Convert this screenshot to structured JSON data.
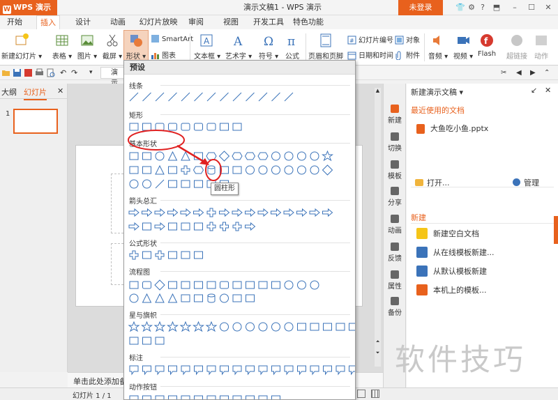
{
  "app": {
    "name": "WPS 演示",
    "logo": "W"
  },
  "window": {
    "title": "演示文稿1 - WPS 演示",
    "login_label": "未登录"
  },
  "menu_tabs": [
    "开始",
    "插入",
    "设计",
    "动画",
    "幻灯片放映",
    "审阅",
    "视图",
    "开发工具",
    "特色功能"
  ],
  "active_tab": "插入",
  "ribbon": {
    "new_slide": "新建幻灯片",
    "table": "表格",
    "picture": "图片",
    "screenshot": "截屏",
    "shape": "形状",
    "smartart": "SmartArt",
    "chart": "图表",
    "textbox": "文本框",
    "wordart": "艺术字",
    "symbol": "符号",
    "formula": "公式",
    "header_footer": "页眉和页脚",
    "slide_number": "幻灯片编号",
    "object": "对象",
    "datetime": "日期和时间",
    "attachment": "附件",
    "audio": "音频",
    "video": "视频",
    "flash": "Flash",
    "hyperlink": "超链接",
    "action": "动作"
  },
  "left_panel": {
    "tab_outline": "大纲",
    "tab_slides": "幻灯片",
    "thumb_number": "1"
  },
  "editor": {
    "notes_placeholder": "单击此处添加备",
    "doc_tab": "演示"
  },
  "status": {
    "slide_counter": "幻灯片 1 / 1"
  },
  "dropdown": {
    "header": "预设",
    "categories": [
      "线条",
      "矩形",
      "基本形状",
      "箭头总汇",
      "公式形状",
      "流程图",
      "星与旗帜",
      "标注",
      "动作按钮"
    ],
    "tooltip": "圆柱形"
  },
  "task_pane": {
    "title": "新建演示文稿",
    "recent_heading": "最近使用的文档",
    "recent_file": "大鱼吃小鱼.pptx",
    "open_label": "打开...",
    "manage_label": "管理",
    "new_heading": "新建",
    "actions": [
      "新建空白文档",
      "从在线模板新建...",
      "从默认模板新建",
      "本机上的模板..."
    ]
  },
  "right_icons": [
    "新建",
    "切换",
    "模板",
    "分享",
    "动画",
    "反馈",
    "属性",
    "备份"
  ],
  "watermark": "软件技巧",
  "colors": {
    "accent": "#e8611d",
    "shape_stroke": "#3b73b9",
    "annotation": "#e02020"
  }
}
